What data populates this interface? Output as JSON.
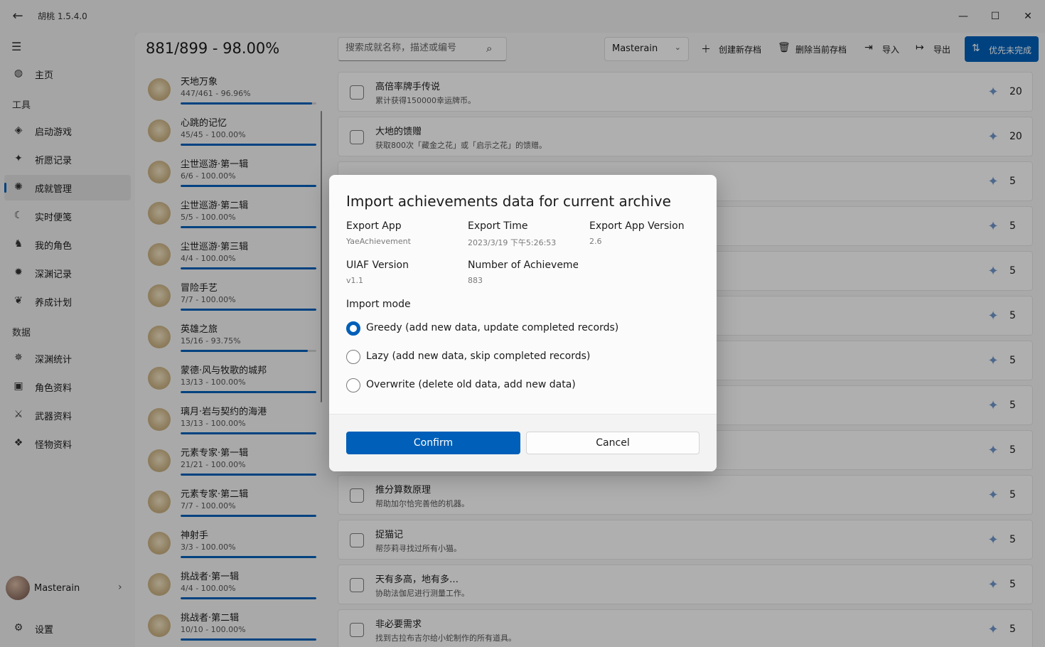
{
  "window": {
    "title": "胡桃 1.5.4.0"
  },
  "nav": {
    "items": [
      {
        "label": "主页",
        "icon": "home-icon",
        "glyph": "◍"
      },
      {
        "label": "启动游戏",
        "icon": "launch-icon",
        "glyph": "◈"
      },
      {
        "label": "祈愿记录",
        "icon": "wish-icon",
        "glyph": "✦"
      },
      {
        "label": "成就管理",
        "icon": "achievement-icon",
        "glyph": "✺",
        "active": true
      },
      {
        "label": "实时便笺",
        "icon": "note-icon",
        "glyph": "☾"
      },
      {
        "label": "我的角色",
        "icon": "character-icon",
        "glyph": "♞"
      },
      {
        "label": "深渊记录",
        "icon": "abyss-icon",
        "glyph": "✹"
      },
      {
        "label": "养成计划",
        "icon": "plan-icon",
        "glyph": "❦"
      },
      {
        "label": "深渊统计",
        "icon": "abyss-stats-icon",
        "glyph": "✵"
      },
      {
        "label": "角色资料",
        "icon": "character-wiki-icon",
        "glyph": "▣"
      },
      {
        "label": "武器资料",
        "icon": "weapon-icon",
        "glyph": "⚔"
      },
      {
        "label": "怪物资料",
        "icon": "monster-icon",
        "glyph": "❖"
      }
    ],
    "sections": {
      "tools": "工具",
      "data": "数据"
    },
    "user": {
      "name": "Masterain"
    },
    "settings_label": "设置"
  },
  "toolbar": {
    "progress": "881/899 - 98.00%",
    "search_placeholder": "搜索成就名称，描述或编号",
    "archive": "Masterain",
    "create_label": "创建新存档",
    "delete_label": "删除当前存档",
    "import_label": "导入",
    "export_label": "导出",
    "priority_label": "优先未完成"
  },
  "categories": [
    {
      "title": "天地万象",
      "sub": "447/461 - 96.96%",
      "progress": 0.9696
    },
    {
      "title": "心跳的记忆",
      "sub": "45/45 - 100.00%",
      "progress": 1.0
    },
    {
      "title": "尘世巡游·第一辑",
      "sub": "6/6 - 100.00%",
      "progress": 1.0
    },
    {
      "title": "尘世巡游·第二辑",
      "sub": "5/5 - 100.00%",
      "progress": 1.0
    },
    {
      "title": "尘世巡游·第三辑",
      "sub": "4/4 - 100.00%",
      "progress": 1.0
    },
    {
      "title": "冒险手艺",
      "sub": "7/7 - 100.00%",
      "progress": 1.0
    },
    {
      "title": "英雄之旅",
      "sub": "15/16 - 93.75%",
      "progress": 0.9375
    },
    {
      "title": "蒙德·风与牧歌的城邦",
      "sub": "13/13 - 100.00%",
      "progress": 1.0
    },
    {
      "title": "璃月·岩与契约的海港",
      "sub": "13/13 - 100.00%",
      "progress": 1.0
    },
    {
      "title": "元素专家·第一辑",
      "sub": "21/21 - 100.00%",
      "progress": 1.0
    },
    {
      "title": "元素专家·第二辑",
      "sub": "7/7 - 100.00%",
      "progress": 1.0
    },
    {
      "title": "神射手",
      "sub": "3/3 - 100.00%",
      "progress": 1.0
    },
    {
      "title": "挑战者·第一辑",
      "sub": "4/4 - 100.00%",
      "progress": 1.0
    },
    {
      "title": "挑战者·第二辑",
      "sub": "10/10 - 100.00%",
      "progress": 1.0
    }
  ],
  "achievements": [
    {
      "title": "高倍率牌手传说",
      "desc": "累计获得150000幸运牌币。",
      "reward": "20"
    },
    {
      "title": "大地的馈赠",
      "desc": "获取800次「藏金之花」或「启示之花」的馈赠。",
      "reward": "20"
    },
    {
      "title": "",
      "desc": "",
      "reward": "5"
    },
    {
      "title": "",
      "desc": "",
      "reward": "5"
    },
    {
      "title": "",
      "desc": "",
      "reward": "5"
    },
    {
      "title": "",
      "desc": "",
      "reward": "5"
    },
    {
      "title": "",
      "desc": "",
      "reward": "5"
    },
    {
      "title": "",
      "desc": "",
      "reward": "5"
    },
    {
      "title": "",
      "desc": "",
      "reward": "5"
    },
    {
      "title": "推分算数原理",
      "desc": "帮助加尔恰完善他的机器。",
      "reward": "5"
    },
    {
      "title": "捉猫记",
      "desc": "帮莎莉寻找过所有小猫。",
      "reward": "5"
    },
    {
      "title": "天有多高，地有多…",
      "desc": "协助法伽尼进行测量工作。",
      "reward": "5"
    },
    {
      "title": "非必要需求",
      "desc": "找到古拉布吉尔给小蛇制作的所有道具。",
      "reward": "5"
    }
  ],
  "dialog": {
    "title": "Import achievements data for current archive",
    "info": [
      {
        "key": "Export App",
        "value": "YaeAchievement"
      },
      {
        "key": "Export Time",
        "value": "2023/3/19 下午5:26:53"
      },
      {
        "key": "Export App Version",
        "value": "2.6"
      },
      {
        "key": "UIAF Version",
        "value": "v1.1"
      },
      {
        "key": "Number of Achievements",
        "value": "883"
      }
    ],
    "mode_label": "Import mode",
    "modes": [
      {
        "label": "Greedy (add new data, update completed records)",
        "checked": true
      },
      {
        "label": "Lazy (add new data, skip completed records)",
        "checked": false
      },
      {
        "label": "Overwrite (delete old data, add new data)",
        "checked": false
      }
    ],
    "confirm_label": "Confirm",
    "cancel_label": "Cancel"
  },
  "colors": {
    "accent": "#005fb8",
    "gem": "#6f95c9"
  }
}
